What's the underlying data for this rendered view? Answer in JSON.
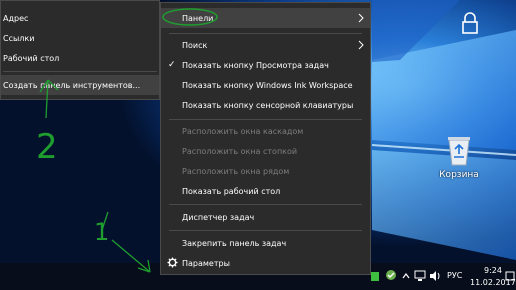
{
  "submenu": {
    "items": [
      {
        "label": "Адрес"
      },
      {
        "label": "Ссылки"
      },
      {
        "label": "Рабочий стол"
      },
      {
        "label": "Создать панель инструментов..."
      }
    ]
  },
  "context_menu": {
    "items": [
      {
        "label": "Панели",
        "has_submenu": true
      },
      {
        "label": "Поиск",
        "has_submenu": true
      },
      {
        "label": "Показать кнопку Просмотра задач",
        "checked": true
      },
      {
        "label": "Показать кнопку Windows Ink Workspace"
      },
      {
        "label": "Показать кнопку сенсорной клавиатуры"
      },
      {
        "label": "Расположить окна каскадом",
        "disabled": true
      },
      {
        "label": "Расположить окна стопкой",
        "disabled": true
      },
      {
        "label": "Расположить окна рядом",
        "disabled": true
      },
      {
        "label": "Показать рабочий стол"
      },
      {
        "label": "Диспетчер задач"
      },
      {
        "label": "Закрепить панель задач"
      },
      {
        "label": "Параметры"
      }
    ]
  },
  "desktop": {
    "recycle_bin_label": "Корзина"
  },
  "taskbar": {
    "language": "РУС",
    "time": "9:24",
    "date": "11.02.2017"
  },
  "annotations": [
    "1",
    "2"
  ],
  "colors": {
    "menu_bg": "#2b2b2b",
    "annotation": "#1f9d2f",
    "wallpaper_dark": "#03112c",
    "wallpaper_light": "#7fd0ff"
  }
}
